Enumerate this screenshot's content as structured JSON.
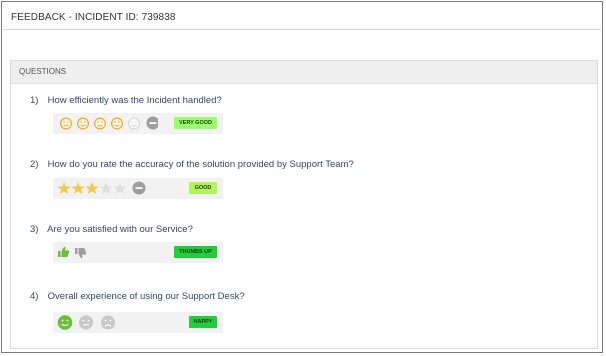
{
  "header": {
    "title": "FEEDBACK - INCIDENT ID: 739838"
  },
  "panel": {
    "title": "QUESTIONS"
  },
  "questions": [
    {
      "number": "1)",
      "text": "How efficiently was the Incident handled?",
      "rating_type": "smileys",
      "max": 5,
      "selected": 5,
      "badge": "VERY GOOD",
      "badge_color": "#9bff6a"
    },
    {
      "number": "2)",
      "text": "How do you rate the accuracy of the solution provided by Support Team?",
      "rating_type": "stars",
      "max": 5,
      "selected": 3,
      "badge": "GOOD",
      "badge_color": "#b6f25a"
    },
    {
      "number": "3)",
      "text": "Are you satisfied with our Service?",
      "rating_type": "thumbs",
      "selected": "up",
      "badge": "THUMBS UP",
      "badge_color": "#22cc3a"
    },
    {
      "number": "4)",
      "text": "Overall experience of using our Support Desk?",
      "rating_type": "faces",
      "selected": "happy",
      "badge": "HAPPY",
      "badge_color": "#22cc3a"
    }
  ],
  "icons": {
    "smiley": "smiley-face-icon",
    "star": "star-icon",
    "thumbs_up": "thumbs-up-icon",
    "thumbs_down": "thumbs-down-icon",
    "clear": "clear-minus-icon",
    "happy": "happy-face-icon",
    "neutral": "neutral-face-icon",
    "sad": "sad-face-icon"
  },
  "colors": {
    "question_text": "#2b4b72",
    "smiley_selected": "#f5a623",
    "star_selected": "#f2c94c",
    "happy_selected": "#6bbf3a"
  }
}
